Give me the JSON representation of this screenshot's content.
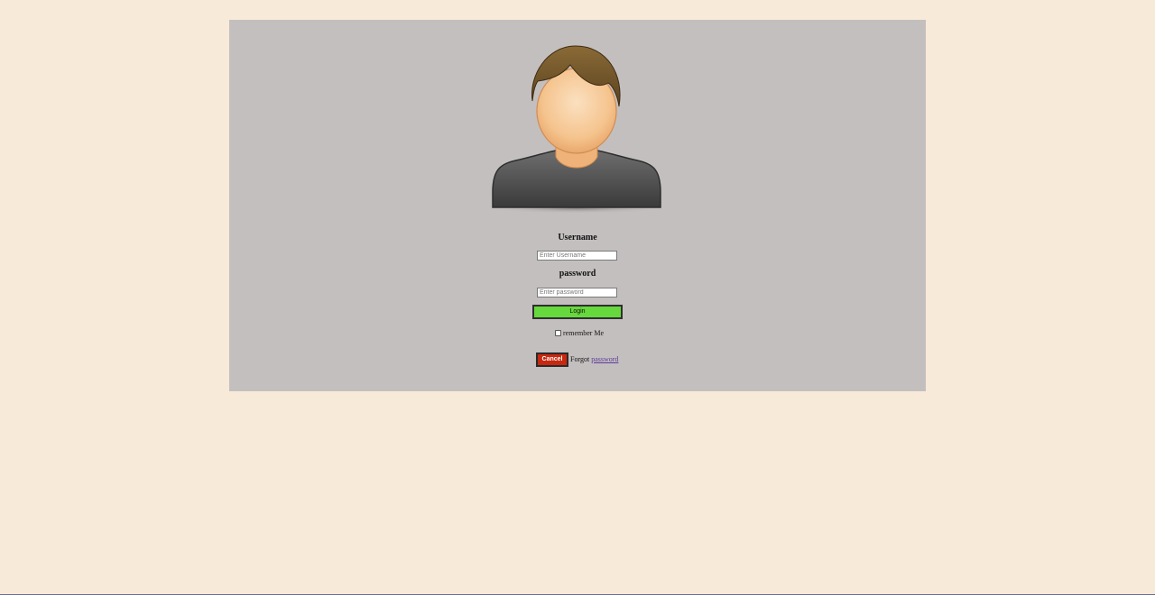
{
  "login_form": {
    "username_label": "Username",
    "username_placeholder": "Enter Username",
    "password_label": "password",
    "password_placeholder": "Enter password",
    "login_button": "Login",
    "remember_label": "remember Me",
    "cancel_button": "Cancel",
    "forgot_text": "Forgot",
    "forgot_link": "password"
  },
  "avatar": {
    "icon": "user-avatar-icon"
  },
  "colors": {
    "page_background": "#f7ead8",
    "panel_background": "#c4bfbf",
    "login_button": "#66d93c",
    "cancel_button": "#c8280f",
    "link": "#5a3c9a"
  }
}
